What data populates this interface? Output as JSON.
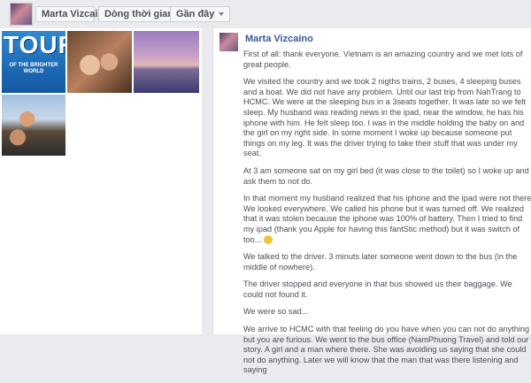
{
  "header": {
    "name": "Marta Vizcaino",
    "timeline_label": "Dòng thời gian",
    "recent_label": "Gần đây"
  },
  "photos": {
    "tour_title": "TOUR",
    "tour_subtitle": "OF THE BRIGHTER WORLD"
  },
  "post": {
    "author": "Marta Vizcaino",
    "paragraphs": [
      "First of all: thank everyone. Vietnam is an amazing country and we met lots of great people.",
      "We visited the country and we took 2 nigths trains, 2 buses, 4 sleeping buses and a boat. We did not have any problem. Until our last trip from NahTrang to HCMC. We were at the sleeping bus in a 3seats together. It was late so we felt sleep. My husband was reading news in the ipad, near the window, he has his iphone with him. He felt sleep too. I was in the middle holding the baby on and the girl on my right side. In some moment I woke up because someone put things on my leg. It was the driver trying to take their stuff that was under my seat.",
      "At 3 am someone sat on my girl bed (it was close to the toilet) so I woke up and ask them to not do.",
      "In that moment my husband realized that his iphone and the ipad were not there! We looked everywhere. We called his phone but it was turned off. We realized that it was stolen because the iphone was 100% of battery. Then I tried to find my ipad (thank you Apple for having this fantStic method) but it was switch of too...",
      "We talked to the driver. 3 minuts later someone went down to the bus (in the middle of nowhere).",
      "The driver stopped and everyone in that bus showed us their baggage. We could not found it.",
      "We were so sad...",
      "We arrive to HCMC with that feeling do you have when you can not do anything but you are furious. We went to the bus office (NamPhuong Travel) and told our story. A girl and a man where there. She was avoiding us saying that she could not do anything. Later we will know that the man that was there listening and saying"
    ]
  }
}
